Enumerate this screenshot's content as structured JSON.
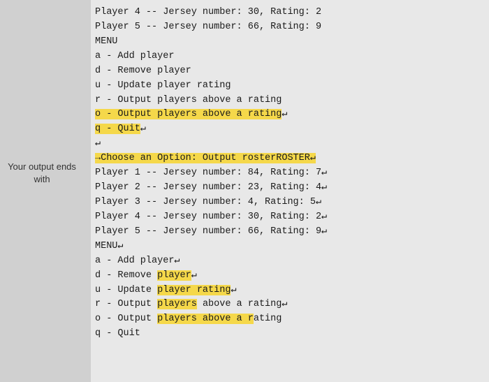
{
  "left_label": {
    "line1": "Your output ends",
    "line2": "with"
  },
  "terminal": {
    "lines": [
      {
        "id": "l1",
        "text": "Player 4 -- Jersey number: 30, Rating: 2",
        "highlight": "none"
      },
      {
        "id": "l2",
        "text": "Player 5 -- Jersey number: 66, Rating: 9",
        "highlight": "none"
      },
      {
        "id": "l3",
        "text": "MENU",
        "highlight": "none"
      },
      {
        "id": "l4",
        "text": "a - Add player",
        "highlight": "none"
      },
      {
        "id": "l5",
        "text": "d - Remove player",
        "highlight": "none"
      },
      {
        "id": "l6",
        "text": "u - Update player rating",
        "highlight": "none"
      },
      {
        "id": "l7",
        "text": "r - Output players above a rating",
        "highlight": "none"
      },
      {
        "id": "l8",
        "text": "o - Output players above a rating",
        "highlight": "full"
      },
      {
        "id": "l9",
        "text": "q - Quit",
        "highlight": "full"
      },
      {
        "id": "l10",
        "text": "",
        "highlight": "none"
      },
      {
        "id": "l11",
        "text": "→Choose an Option: Output rosterROSTER↵",
        "highlight": "partial_arrow"
      },
      {
        "id": "l12",
        "text": "Player 1 -- Jersey number: 84, Rating: 7↵",
        "highlight": "none"
      },
      {
        "id": "l13",
        "text": "Player 2 -- Jersey number: 23, Rating: 4↵",
        "highlight": "none"
      },
      {
        "id": "l14",
        "text": "Player 3 -- Jersey number: 4, Rating: 5↵",
        "highlight": "none"
      },
      {
        "id": "l15",
        "text": "Player 4 -- Jersey number: 30, Rating: 2↵",
        "highlight": "none"
      },
      {
        "id": "l16",
        "text": "Player 5 -- Jersey number: 66, Rating: 9↵",
        "highlight": "none"
      },
      {
        "id": "l17",
        "text": "MENU↵",
        "highlight": "none"
      },
      {
        "id": "l18",
        "text": "a - Add player↵",
        "highlight": "none"
      },
      {
        "id": "l19",
        "text": "d - Remove player↵",
        "highlight": "none"
      },
      {
        "id": "l20",
        "text": "u - Update player rating↵",
        "highlight": "none"
      },
      {
        "id": "l21",
        "text": "r - Output players above a rating↵",
        "highlight": "none"
      },
      {
        "id": "l22",
        "text": "o - Output players above a rating",
        "highlight": "partial_o"
      },
      {
        "id": "l23",
        "text": "q - Quit",
        "highlight": "none"
      }
    ]
  }
}
